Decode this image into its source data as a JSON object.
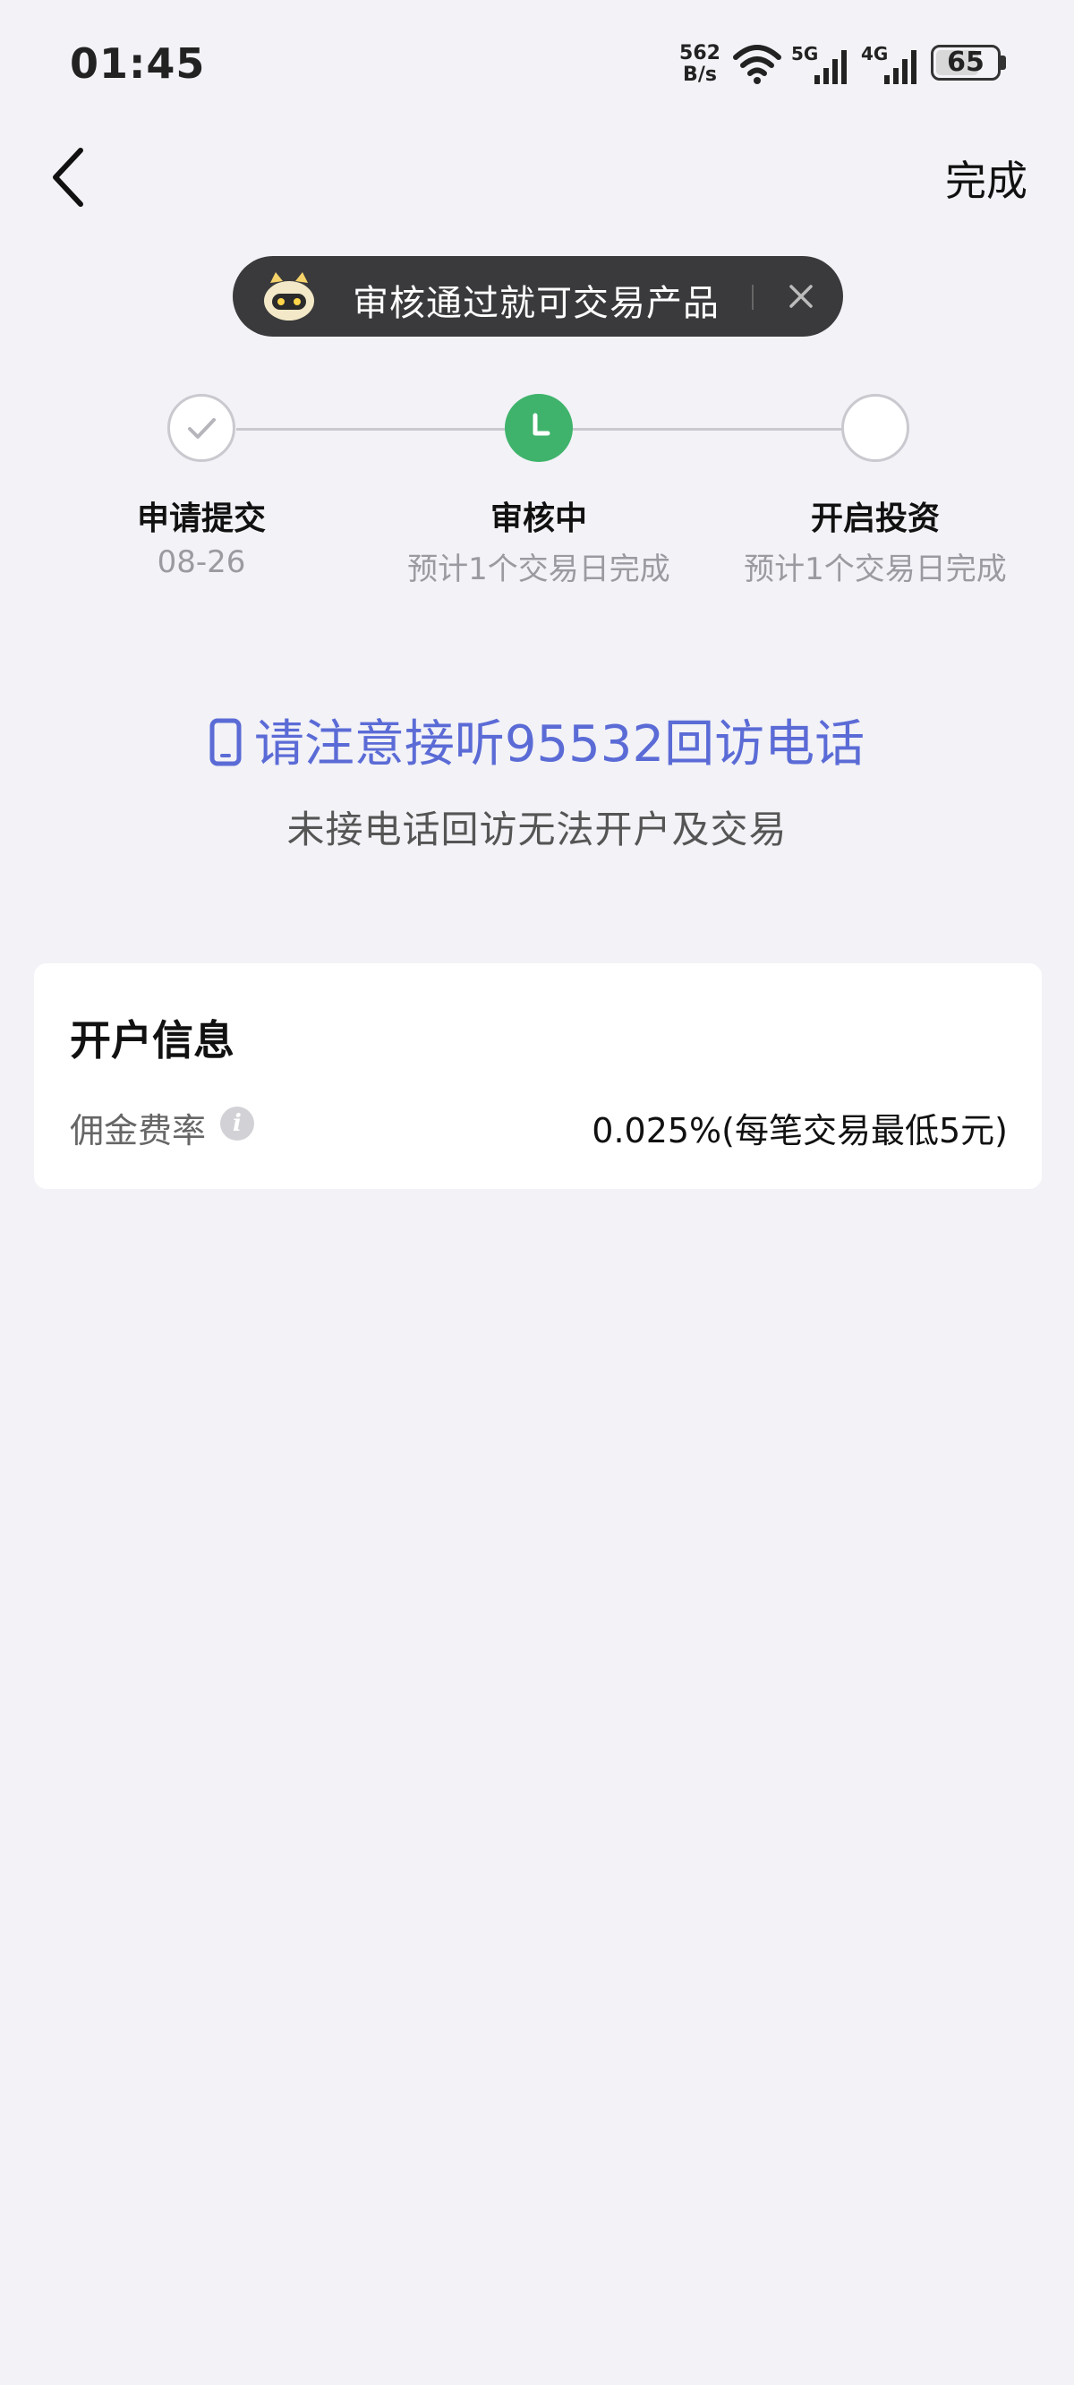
{
  "status_bar": {
    "time": "01:45",
    "net_speed_value": "562",
    "net_speed_unit": "B/s",
    "signal_1_label": "5G",
    "signal_2_label": "4G",
    "battery_level": "65"
  },
  "nav": {
    "done_label": "完成"
  },
  "toast": {
    "text": "审核通过就可交易产品"
  },
  "steps": [
    {
      "title": "申请提交",
      "subtitle": "08-26",
      "state": "done"
    },
    {
      "title": "审核中",
      "subtitle": "预计1个交易日完成",
      "state": "active"
    },
    {
      "title": "开启投资",
      "subtitle": "预计1个交易日完成",
      "state": "pending"
    }
  ],
  "notice": {
    "title": "请注意接听95532回访电话",
    "subtitle": "未接电话回访无法开户及交易"
  },
  "account_card": {
    "title": "开户信息",
    "commission_label": "佣金费率",
    "commission_value": "0.025%(每笔交易最低5元)"
  },
  "colors": {
    "accent": "#5b6bd6",
    "step_active": "#3fb36b",
    "background": "#f2f2f7"
  }
}
